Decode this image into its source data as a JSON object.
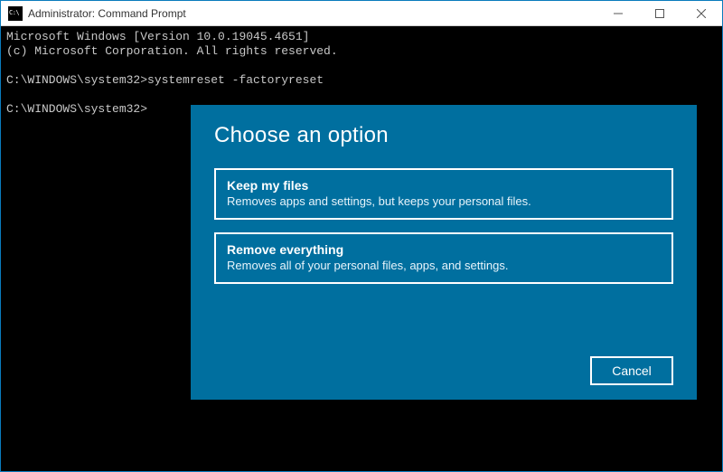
{
  "window": {
    "title": "Administrator: Command Prompt"
  },
  "console": {
    "line1": "Microsoft Windows [Version 10.0.19045.4651]",
    "line2": "(c) Microsoft Corporation. All rights reserved.",
    "blank1": "",
    "line3": "C:\\WINDOWS\\system32>systemreset -factoryreset",
    "blank2": "",
    "line4": "C:\\WINDOWS\\system32>"
  },
  "dialog": {
    "heading": "Choose an option",
    "options": [
      {
        "title": "Keep my files",
        "desc": "Removes apps and settings, but keeps your personal files."
      },
      {
        "title": "Remove everything",
        "desc": "Removes all of your personal files, apps, and settings."
      }
    ],
    "cancel": "Cancel"
  }
}
